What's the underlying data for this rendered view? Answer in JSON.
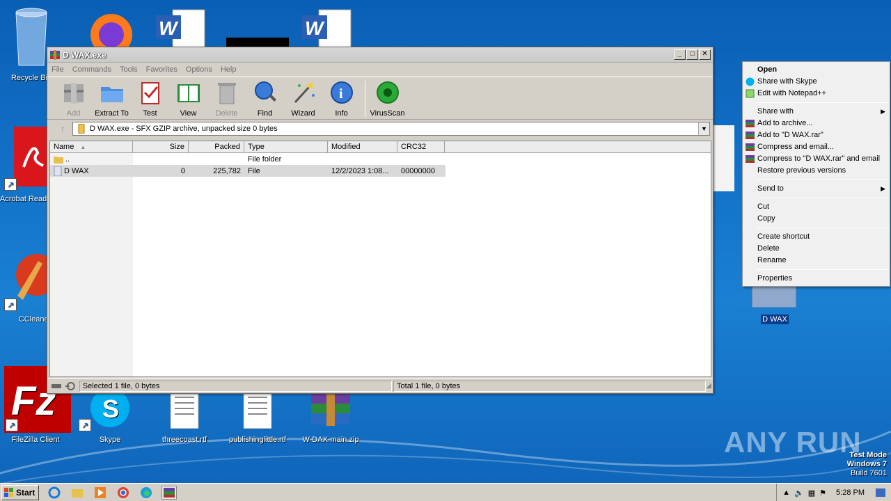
{
  "desktop": {
    "icons": [
      {
        "label": "Recycle Bin"
      },
      {
        "label": "Acrobat Reader DC"
      },
      {
        "label": "CCleaner"
      },
      {
        "label": "FileZilla Client"
      },
      {
        "label": "Skype"
      },
      {
        "label": "threecoast.rtf"
      },
      {
        "label": "publishinglittle.rtf"
      },
      {
        "label": "W-DAX-main.zip"
      },
      {
        "label": "D WAX"
      }
    ],
    "watermark_brand": "ANY RUN",
    "os_lines": [
      "Test Mode",
      "Windows 7",
      "Build 7601"
    ]
  },
  "winrar": {
    "title": "D WAX.exe",
    "menu": [
      "File",
      "Commands",
      "Tools",
      "Favorites",
      "Options",
      "Help"
    ],
    "toolbar": [
      {
        "label": "Add",
        "icon": "add-icon",
        "enabled": false
      },
      {
        "label": "Extract To",
        "icon": "extract-icon",
        "enabled": true
      },
      {
        "label": "Test",
        "icon": "test-icon",
        "enabled": true
      },
      {
        "label": "View",
        "icon": "view-icon",
        "enabled": true
      },
      {
        "label": "Delete",
        "icon": "delete-icon",
        "enabled": false
      },
      {
        "label": "Find",
        "icon": "find-icon",
        "enabled": true
      },
      {
        "label": "Wizard",
        "icon": "wizard-icon",
        "enabled": true
      },
      {
        "label": "Info",
        "icon": "info-icon",
        "enabled": true
      },
      {
        "label": "VirusScan",
        "icon": "virusscan-icon",
        "enabled": true
      }
    ],
    "address": "D WAX.exe - SFX GZIP archive, unpacked size 0 bytes",
    "columns": [
      "Name",
      "Size",
      "Packed",
      "Type",
      "Modified",
      "CRC32"
    ],
    "rows": [
      {
        "name": "..",
        "size": "",
        "packed": "",
        "type": "File folder",
        "modified": "",
        "crc": ""
      },
      {
        "name": "D WAX",
        "size": "0",
        "packed": "225,782",
        "type": "File",
        "modified": "12/2/2023 1:08...",
        "crc": "00000000"
      }
    ],
    "status_left": "Selected 1 file, 0 bytes",
    "status_right": "Total 1 file, 0 bytes"
  },
  "context_menu": {
    "groups": [
      [
        {
          "label": "Open",
          "bold": true
        },
        {
          "label": "Share with Skype",
          "icon": "skype-icon"
        },
        {
          "label": "Edit with Notepad++",
          "icon": "notepadpp-icon"
        }
      ],
      [
        {
          "label": "Share with",
          "submenu": true
        },
        {
          "label": "Add to archive...",
          "icon": "winrar-icon"
        },
        {
          "label": "Add to \"D WAX.rar\"",
          "icon": "winrar-icon"
        },
        {
          "label": "Compress and email...",
          "icon": "winrar-icon"
        },
        {
          "label": "Compress to \"D WAX.rar\" and email",
          "icon": "winrar-icon"
        },
        {
          "label": "Restore previous versions"
        }
      ],
      [
        {
          "label": "Send to",
          "submenu": true
        }
      ],
      [
        {
          "label": "Cut"
        },
        {
          "label": "Copy"
        }
      ],
      [
        {
          "label": "Create shortcut"
        },
        {
          "label": "Delete"
        },
        {
          "label": "Rename"
        }
      ],
      [
        {
          "label": "Properties"
        }
      ]
    ]
  },
  "taskbar": {
    "start_label": "Start",
    "apps": [
      "internet-explorer-icon",
      "explorer-icon",
      "media-player-icon",
      "chrome-icon",
      "edge-icon",
      "winrar-icon"
    ],
    "clock": "5:28 PM"
  }
}
